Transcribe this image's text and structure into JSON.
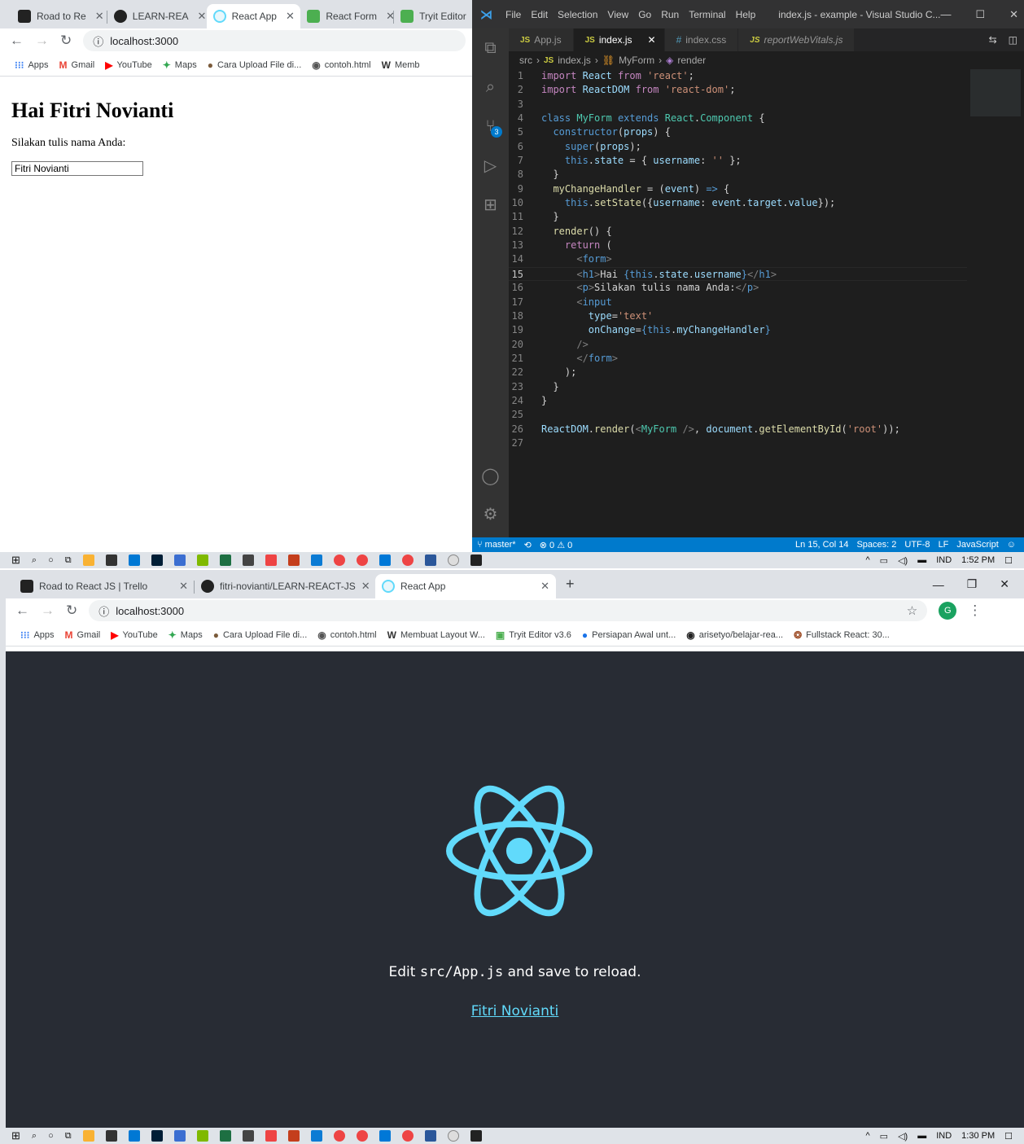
{
  "top_browser": {
    "tabs": [
      {
        "label": "Road to Re",
        "icon": "trello-icon"
      },
      {
        "label": "LEARN-REA",
        "icon": "github-icon"
      },
      {
        "label": "React App",
        "icon": "react-icon"
      },
      {
        "label": "React Form",
        "icon": "w3schools-icon"
      },
      {
        "label": "Tryit Editor",
        "icon": "w3schools-icon"
      }
    ],
    "url": "localhost:3000",
    "bookmarks": [
      "Apps",
      "Gmail",
      "YouTube",
      "Maps",
      "Cara Upload File di...",
      "contoh.html",
      "Memb"
    ],
    "page": {
      "heading": "Hai Fitri Novianti",
      "prompt": "Silakan tulis nama Anda:",
      "input_value": "Fitri Novianti"
    }
  },
  "vscode": {
    "menu": [
      "File",
      "Edit",
      "Selection",
      "View",
      "Go",
      "Run",
      "Terminal",
      "Help"
    ],
    "title": "index.js - example - Visual Studio C...",
    "tabs": [
      {
        "label": "App.js"
      },
      {
        "label": "index.js"
      },
      {
        "label": "index.css"
      },
      {
        "label": "reportWebVitals.js"
      }
    ],
    "breadcrumb": [
      "src",
      "index.js",
      "MyForm",
      "render"
    ],
    "source_control_badge": "3",
    "status": {
      "branch": "master*",
      "problems": "⊗ 0 ⚠ 0",
      "position": "Ln 15, Col 14",
      "spaces": "Spaces: 2",
      "encoding": "UTF-8",
      "eol": "LF",
      "language": "JavaScript"
    }
  },
  "taskbar_top": {
    "lang": "IND",
    "time": "1:52 PM"
  },
  "bottom_browser": {
    "tabs": [
      {
        "label": "Road to React JS | Trello",
        "icon": "trello-icon"
      },
      {
        "label": "fitri-novianti/LEARN-REACT-JS",
        "icon": "github-icon"
      },
      {
        "label": "React App",
        "icon": "react-icon"
      }
    ],
    "url": "localhost:3000",
    "profile_initial": "G",
    "bookmarks": [
      "Apps",
      "Gmail",
      "YouTube",
      "Maps",
      "Cara Upload File di...",
      "contoh.html",
      "Membuat Layout W...",
      "Tryit Editor v3.6",
      "Persiapan Awal unt...",
      "arisetyo/belajar-rea...",
      "Fullstack React: 30..."
    ],
    "page": {
      "text_before": "Edit ",
      "code": "src/App.js",
      "text_after": " and save to reload.",
      "link": "Fitri Novianti"
    }
  },
  "taskbar_bottom": {
    "lang": "IND",
    "time": "1:30 PM"
  }
}
